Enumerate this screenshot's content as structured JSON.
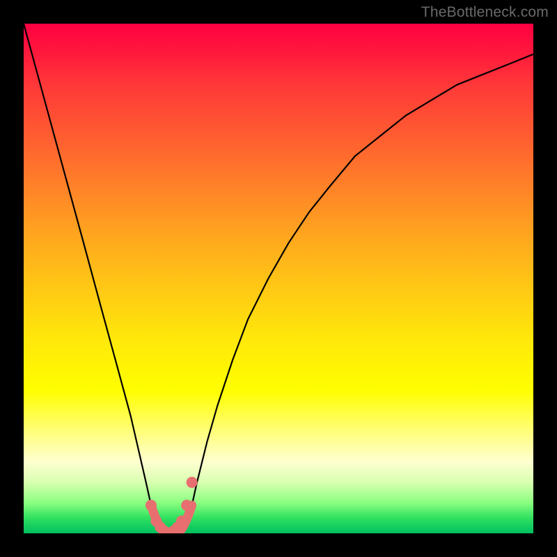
{
  "watermark": "TheBottleneck.com",
  "chart_data": {
    "type": "line",
    "title": "",
    "xlabel": "",
    "ylabel": "",
    "xlim": [
      0,
      100
    ],
    "ylim": [
      0,
      100
    ],
    "gradient_stops": [
      {
        "pos": 0,
        "color": "#ff0040"
      },
      {
        "pos": 12,
        "color": "#ff3838"
      },
      {
        "pos": 30,
        "color": "#ff7a2a"
      },
      {
        "pos": 50,
        "color": "#ffc216"
      },
      {
        "pos": 72,
        "color": "#fffe00"
      },
      {
        "pos": 86,
        "color": "#feffd0"
      },
      {
        "pos": 94,
        "color": "#8aff80"
      },
      {
        "pos": 100,
        "color": "#00c060"
      }
    ],
    "series": [
      {
        "name": "curve",
        "x": [
          0,
          3,
          6,
          9,
          12,
          15,
          18,
          21,
          24,
          25,
          26,
          27,
          28,
          29,
          30,
          31,
          32,
          33,
          34,
          36,
          38,
          41,
          44,
          48,
          52,
          56,
          60,
          65,
          70,
          75,
          80,
          85,
          90,
          95,
          100
        ],
        "y": [
          100,
          89,
          78,
          67,
          56,
          45,
          34,
          23,
          10,
          5.5,
          2.4,
          0.8,
          0.15,
          0.0,
          0.15,
          0.8,
          2.4,
          5.5,
          10,
          18,
          25,
          34,
          42,
          50,
          57,
          63,
          68,
          74,
          78,
          82,
          85,
          88,
          90,
          92,
          94
        ]
      },
      {
        "name": "highlight-dots",
        "x": [
          25.0,
          26.0,
          26.8,
          27.6,
          29.4,
          30.2,
          31.0,
          32.0,
          33.0
        ],
        "y": [
          5.5,
          2.4,
          1.2,
          0.45,
          0.45,
          1.2,
          2.4,
          5.5,
          10
        ]
      }
    ],
    "highlight_color": "#e76f6f",
    "curve_color": "#000000",
    "min_point": {
      "x": 29,
      "y": 0
    }
  }
}
